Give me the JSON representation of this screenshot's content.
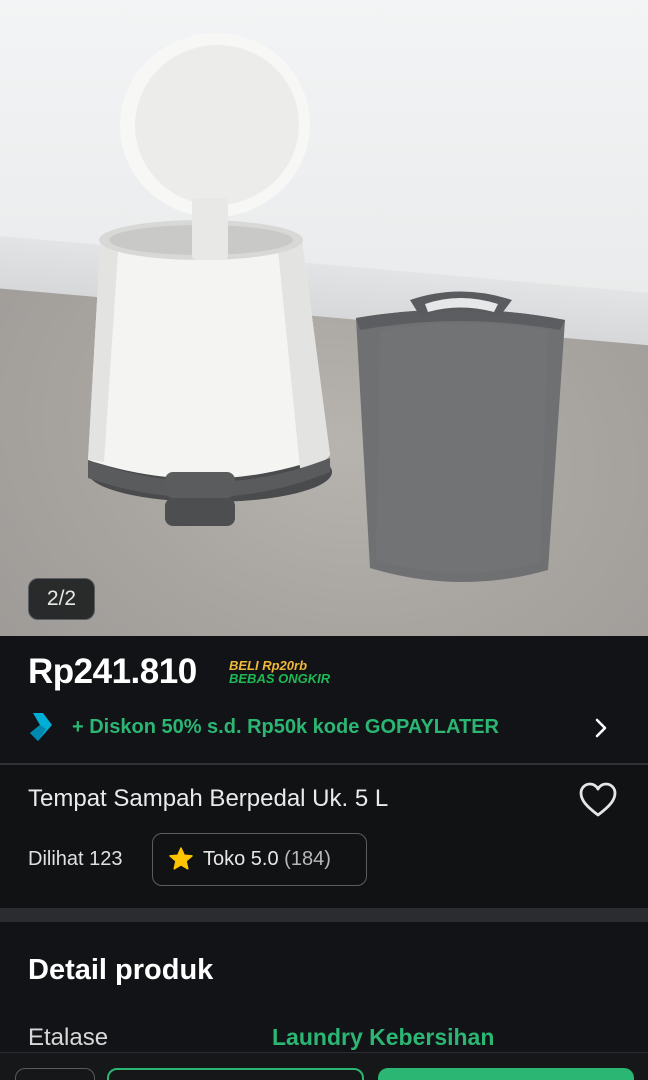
{
  "gallery": {
    "indicator": "2/2"
  },
  "price": {
    "amount": "Rp241.810",
    "shipping_line1": "BELI Rp20rb",
    "shipping_line2": "BEBAS ONGKIR"
  },
  "promo": {
    "text": "+ Diskon 50% s.d. Rp50k kode GOPAYLATER"
  },
  "product": {
    "title": "Tempat Sampah Berpedal Uk. 5 L",
    "views": "Dilihat 123",
    "rating_label": "Toko 5.0",
    "rating_count": "(184)"
  },
  "detail": {
    "heading": "Detail produk",
    "rows": [
      {
        "label": "Etalase",
        "value": "Laundry Kebersihan"
      }
    ]
  },
  "colors": {
    "accent": "#2bb673",
    "promo_yellow": "#f0b83a",
    "background": "#121316"
  },
  "icons": {
    "wishlist": "heart-icon",
    "rating": "star-icon",
    "promo": "gopay-icon",
    "more": "chevron-right-icon"
  }
}
